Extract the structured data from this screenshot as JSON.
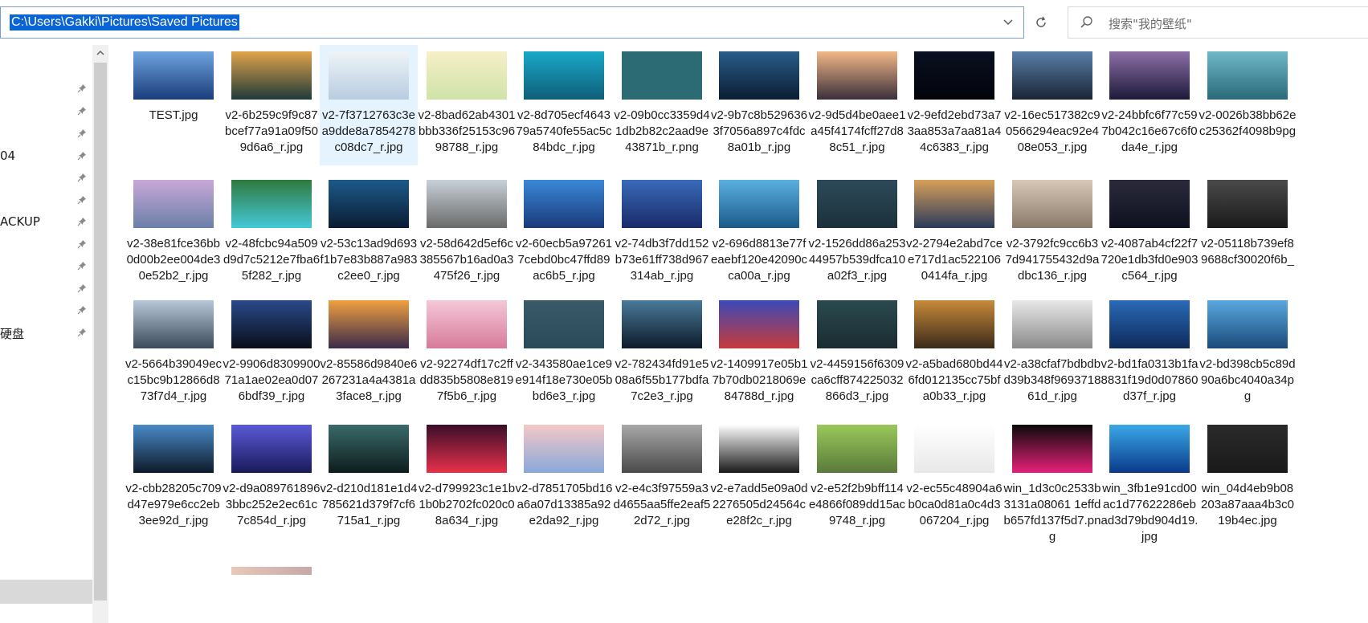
{
  "address_bar": {
    "path": "C:\\Users\\Gakki\\Pictures\\Saved Pictures"
  },
  "search": {
    "placeholder": "搜索\"我的壁纸\""
  },
  "colors": {
    "accent": "#0a64d4",
    "selection": "#e5f3ff",
    "nav_selected": "#d9d9d9"
  },
  "nav": {
    "items": [
      {
        "label": "",
        "pinned": true
      },
      {
        "label": "",
        "pinned": true
      },
      {
        "label": "",
        "pinned": true
      },
      {
        "label": "04",
        "pinned": true
      },
      {
        "label": "",
        "pinned": true
      },
      {
        "label": "",
        "pinned": true
      },
      {
        "label": "ACKUP",
        "pinned": true
      },
      {
        "label": "",
        "pinned": true
      },
      {
        "label": "",
        "pinned": true
      },
      {
        "label": "",
        "pinned": true
      },
      {
        "label": "",
        "pinned": true
      },
      {
        "label": "硬盘",
        "pinned": true
      }
    ]
  },
  "files": [
    {
      "name": "TEST.jpg",
      "thumb": [
        "#6fa4e0",
        "#1a3d7a"
      ]
    },
    {
      "name": "v2-6b259c9f9c87bcef77a91a09f509d6a6_r.jpg",
      "thumb": [
        "#e0a44a",
        "#1f3a3a"
      ]
    },
    {
      "name": "v2-7f3712763c3ea9dde8a7854278c08dc7_r.jpg",
      "thumb": [
        "#eef4f8",
        "#b8cce0"
      ]
    },
    {
      "name": "v2-8bad62ab4301bbb336f25153c9698788_r.jpg",
      "thumb": [
        "#f7efc8",
        "#cfe3a8"
      ]
    },
    {
      "name": "v2-8d705ecf464379a5740fe55ac5c84bdc_r.jpg",
      "thumb": [
        "#1aa8c8",
        "#0e5f7a"
      ]
    },
    {
      "name": "v2-09b0cc3359d41db2b82c2aad9e43871b_r.png",
      "thumb": [
        "#2c6b74",
        "#2c6b74"
      ]
    },
    {
      "name": "v2-9b7c8b5296363f7056a897c4fdc8a01b_r.jpg",
      "thumb": [
        "#2a5d8a",
        "#0b1d33"
      ]
    },
    {
      "name": "v2-9d5d4be0aee1a45f4174fcff27d88c51_r.jpg",
      "thumb": [
        "#f3b888",
        "#3a2f3a"
      ]
    },
    {
      "name": "v2-9efd2ebd73a73aa853a7aa81a44c6383_r.jpg",
      "thumb": [
        "#0a1022",
        "#02040a"
      ]
    },
    {
      "name": "v2-16ec517382c90566294eac92e408e053_r.jpg",
      "thumb": [
        "#5a7ea8",
        "#1a2535"
      ]
    },
    {
      "name": "v2-24bbfc6f77c597b042c16e67c6f0da4e_r.jpg",
      "thumb": [
        "#8d6fa8",
        "#1e1a3a"
      ]
    },
    {
      "name": "v2-0026b38bb62ec25362f4098b9pg",
      "thumb": [
        "#6fb8c8",
        "#2a6a7a"
      ]
    },
    {
      "name": "v2-38e81fce36bb0d00b2ee004de30e52b2_r.jpg",
      "thumb": [
        "#c9a8d8",
        "#6a7fa8"
      ]
    },
    {
      "name": "v2-48fcbc94a509d9d7c5212e7fba65f282_r.jpg",
      "thumb": [
        "#2f7a3e",
        "#45c8d8"
      ]
    },
    {
      "name": "v2-53c13ad9d693f1b7e83b887a983c2ee0_r.jpg",
      "thumb": [
        "#1c5a8a",
        "#0b1c33"
      ]
    },
    {
      "name": "v2-58d642d5ef6c385567b16ad0a3475f26_r.jpg",
      "thumb": [
        "#c8d0d8",
        "#6a6a6a"
      ]
    },
    {
      "name": "v2-60ecb5a972617cebd0bc47ffd89ac6b5_r.jpg",
      "thumb": [
        "#3a88d8",
        "#1a3a7a"
      ]
    },
    {
      "name": "v2-74db3f7dd152b73e61ff738d967314ab_r.jpg",
      "thumb": [
        "#3a6ab8",
        "#1a2a6a"
      ]
    },
    {
      "name": "v2-696d8813e77feaebf120e42090cca00a_r.jpg",
      "thumb": [
        "#5ab0e0",
        "#1a5a8a"
      ]
    },
    {
      "name": "v2-1526dd86a25344957b539dfca10a02f3_r.jpg",
      "thumb": [
        "#2d4a58",
        "#1c303c"
      ]
    },
    {
      "name": "v2-2794e2abd7cee717d1ac5221060414fa_r.jpg",
      "thumb": [
        "#d8a05a",
        "#2a3a5a"
      ]
    },
    {
      "name": "v2-3792fc9cc6b37d941755432d9adbc136_r.jpg",
      "thumb": [
        "#d8c8b8",
        "#8a7a6a"
      ]
    },
    {
      "name": "v2-4087ab4cf22f7720e1db3fd0e903c564_r.jpg",
      "thumb": [
        "#2a2a3a",
        "#0e1020"
      ]
    },
    {
      "name": "v2-05118b739ef89688cf30020f6b_",
      "thumb": [
        "#4a4a4a",
        "#1a1a1a"
      ]
    },
    {
      "name": "v2-5664b39049ecc15bc9b12866d873f7d4_r.jpg",
      "thumb": [
        "#b8c8d8",
        "#3a4a5a"
      ]
    },
    {
      "name": "v2-9906d830990071a1ae02ea0d076bdf39_r.jpg",
      "thumb": [
        "#2a4a8a",
        "#0a0e1a"
      ]
    },
    {
      "name": "v2-85586d9840e6267231a4a4381a3face8_r.jpg",
      "thumb": [
        "#f0a040",
        "#3a2a4a"
      ]
    },
    {
      "name": "v2-92274df17c2ffdd835b5808e8197f5b6_r.jpg",
      "thumb": [
        "#f4c8d8",
        "#d87a9a"
      ]
    },
    {
      "name": "v2-343580ae1ce9e914f18e730e05bbd6e3_r.jpg",
      "thumb": [
        "#3a5a6a",
        "#2a4a5a"
      ]
    },
    {
      "name": "v2-782434fd91e508a6f55b177bdfa7c2e3_r.jpg",
      "thumb": [
        "#4a7a9a",
        "#0e1a2a"
      ]
    },
    {
      "name": "v2-1409917e05b17b70db0218069e84788d_r.jpg",
      "thumb": [
        "#3a4ab8",
        "#c83a3a"
      ]
    },
    {
      "name": "v2-4459156f6309ca6cff874225032866d3_r.jpg",
      "thumb": [
        "#2a4a50",
        "#1a2c30"
      ]
    },
    {
      "name": "v2-a5bad680bd446fd012135cc75bfa0b33_r.jpg",
      "thumb": [
        "#c88a3a",
        "#3a2a1a"
      ]
    },
    {
      "name": "v2-a38cfaf7bdbdbd39b348f969371861d_r.jpg",
      "thumb": [
        "#e8e8e8",
        "#8a8a8a"
      ]
    },
    {
      "name": "v2-bd1fa0313b1fa8831f19d0d07860d37f_r.jpg",
      "thumb": [
        "#2a6ab8",
        "#0e2a5a"
      ]
    },
    {
      "name": "v2-bd398cb5c89d90a6bc4040a34pg",
      "thumb": [
        "#5aa8e0",
        "#1a4a7a"
      ]
    },
    {
      "name": "v2-cbb28205c709d47e979e6cc2eb3ee92d_r.jpg",
      "thumb": [
        "#4a8ac8",
        "#0e1a2a"
      ]
    },
    {
      "name": "v2-d9a0897618963bbc252e2ec61c7c854d_r.jpg",
      "thumb": [
        "#5a5ad8",
        "#1a1a5a"
      ]
    },
    {
      "name": "v2-d210d181e1d4785621d379f7cf6715a1_r.jpg",
      "thumb": [
        "#3a6a6a",
        "#0e1c1c"
      ]
    },
    {
      "name": "v2-d799923c1e1b1b0b2702fc020c08a634_r.jpg",
      "thumb": [
        "#3a0e2a",
        "#e8304a"
      ]
    },
    {
      "name": "v2-d7851705bd16a6a07d13385a92e2da92_r.jpg",
      "thumb": [
        "#f4c8c8",
        "#8aa8d8"
      ]
    },
    {
      "name": "v2-e4c3f97559a3d4655aa5ffe2eaf52d72_r.jpg",
      "thumb": [
        "#a8a8a8",
        "#4a4a4a"
      ]
    },
    {
      "name": "v2-e7add5e09a0d2276505d24564ce28f2c_r.jpg",
      "thumb": [
        "#ffffff",
        "#1a1a1a"
      ]
    },
    {
      "name": "v2-e52f2b9bff114e4866f089dd15ac9748_r.jpg",
      "thumb": [
        "#9ac85a",
        "#5a7a3a"
      ]
    },
    {
      "name": "v2-ec55c48904a6b0ca0d81a0c4d3067204_r.jpg",
      "thumb": [
        "#ffffff",
        "#e8e8e8"
      ]
    },
    {
      "name": "win_1d3c0c2533b3131a08061 1effdb657fd137f5d7.png",
      "thumb": [
        "#0a0a0a",
        "#e8207a"
      ]
    },
    {
      "name": "win_3fb1e91cd00ac1d77622286ebad3d79bd904d19.jpg",
      "thumb": [
        "#3aa8e8",
        "#0a3a8a"
      ]
    },
    {
      "name": "win_04d4eb9b08203a87aaa4b3c019b4ec.jpg",
      "thumb": [
        "#2a2a2a",
        "#1a1a1a"
      ]
    }
  ]
}
